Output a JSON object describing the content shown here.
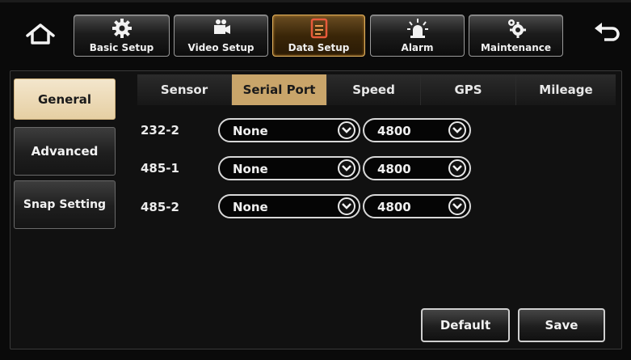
{
  "toolbar": {
    "basic_setup": "Basic Setup",
    "video_setup": "Video Setup",
    "data_setup": "Data Setup",
    "alarm": "Alarm",
    "maintenance": "Maintenance",
    "icons": {
      "home": "home-icon",
      "basic_setup": "gear-icon",
      "video_setup": "camera-icon",
      "data_setup": "data-icon",
      "alarm": "alarm-light-icon",
      "maintenance": "gears-icon",
      "back": "back-arrow-icon"
    }
  },
  "sidebar": {
    "items": [
      {
        "label": "General",
        "active": true
      },
      {
        "label": "Advanced",
        "active": false
      },
      {
        "label": "Snap Setting",
        "active": false
      }
    ]
  },
  "tabs": [
    {
      "label": "Sensor",
      "active": false
    },
    {
      "label": "Serial Port",
      "active": true
    },
    {
      "label": "Speed",
      "active": false
    },
    {
      "label": "GPS",
      "active": false
    },
    {
      "label": "Mileage",
      "active": false
    }
  ],
  "ports": [
    {
      "name": "232-2",
      "device": "None",
      "baud": "4800"
    },
    {
      "name": "485-1",
      "device": "None",
      "baud": "4800"
    },
    {
      "name": "485-2",
      "device": "None",
      "baud": "4800"
    }
  ],
  "actions": {
    "default_label": "Default",
    "save_label": "Save"
  },
  "colors": {
    "accent": "#c9a56a",
    "active_sidebar": "#e6cfa3",
    "active_top": "#e0b260"
  }
}
